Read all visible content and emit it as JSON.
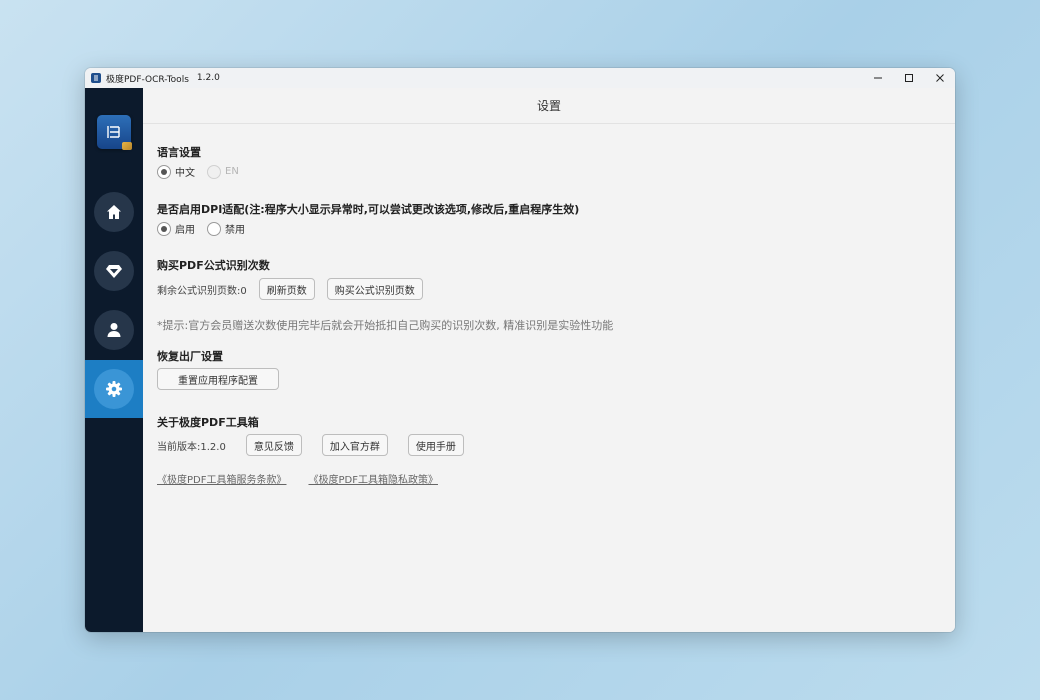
{
  "window": {
    "title": "极度PDF-OCR-Tools",
    "version": "1.2.0"
  },
  "header": {
    "title": "设置"
  },
  "sidebar": {
    "items": [
      {
        "name": "home",
        "icon": "home-icon",
        "active": false
      },
      {
        "name": "vip",
        "icon": "diamond-icon",
        "active": false
      },
      {
        "name": "user",
        "icon": "user-icon",
        "active": false
      },
      {
        "name": "settings",
        "icon": "gear-icon",
        "active": true
      }
    ]
  },
  "language": {
    "title": "语言设置",
    "options": [
      "中文",
      "EN"
    ],
    "selected": "中文"
  },
  "dpi": {
    "title": "是否启用DPI适配(注:程序大小显示异常时,可以尝试更改该选项,修改后,重启程序生效)",
    "options": [
      "启用",
      "禁用"
    ],
    "selected": "启用"
  },
  "purchase": {
    "title": "购买PDF公式识别次数",
    "remaining_label": "剩余公式识别页数:0",
    "refresh_label": "刷新页数",
    "buy_label": "购买公式识别页数",
    "hint": "*提示:官方会员赠送次数使用完毕后就会开始抵扣自己购买的识别次数, 精准识别是实验性功能"
  },
  "reset": {
    "title": "恢复出厂设置",
    "button_label": "重置应用程序配置"
  },
  "about": {
    "title": "关于极度PDF工具箱",
    "version_label": "当前版本:1.2.0",
    "feedback_label": "意见反馈",
    "group_label": "加入官方群",
    "manual_label": "使用手册",
    "terms_link": "《极度PDF工具箱服务条款》",
    "privacy_link": "《极度PDF工具箱隐私政策》"
  },
  "colors": {
    "sidebar_bg": "#0c1a2c",
    "active_nav": "#1d7ec4",
    "content_bg": "#f3f3f3"
  }
}
